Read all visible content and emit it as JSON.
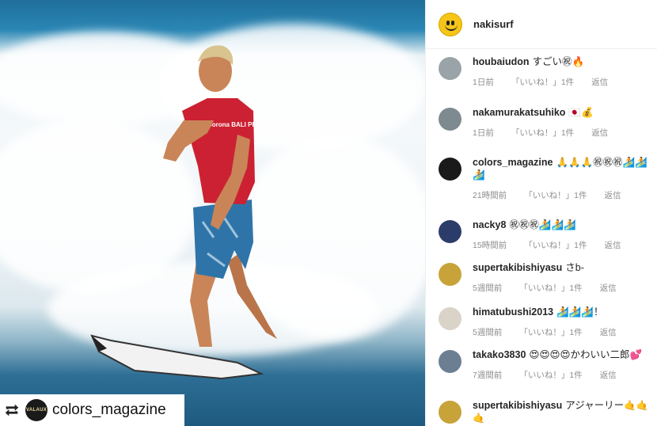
{
  "photo": {
    "repost_label": "colors_magazine",
    "repost_avatar_text": "VALAUX",
    "jersey_text": "Corona BALI PROTECTED"
  },
  "header": {
    "username": "nakisurf"
  },
  "comments": [
    {
      "user": "houbaiudon",
      "text": "すごい㊗🔥",
      "time": "1日前",
      "likes": "「いいね！」1件",
      "reply": "返信",
      "avatar_color": "#9aa3a8"
    },
    {
      "user": "nakamurakatsuhiko",
      "text": "🇯🇵💰",
      "time": "1日前",
      "likes": "「いいね！」1件",
      "reply": "返信",
      "avatar_color": "#7d8a90"
    },
    {
      "user": "colors_magazine",
      "text": "🙏🙏🙏㊗㊗㊗🏄🏄🏄",
      "time": "21時間前",
      "likes": "「いいね！」1件",
      "reply": "返信",
      "avatar_color": "#1a1a1a"
    },
    {
      "user": "nacky8",
      "text": "㊗㊗㊗🏄🏄🏄",
      "time": "15時間前",
      "likes": "「いいね！」1件",
      "reply": "返信",
      "avatar_color": "#2c3c6a"
    },
    {
      "user": "supertakibishiyasu",
      "text": "さb-",
      "time": "5週間前",
      "likes": "「いいね！」1件",
      "reply": "返信",
      "avatar_color": "#c7a33a"
    },
    {
      "user": "himatubushi2013",
      "text": "🏄🏄🏄！",
      "time": "5週間前",
      "likes": "「いいね！」1件",
      "reply": "返信",
      "avatar_color": "#d9d3c8"
    },
    {
      "user": "takako3830",
      "text": "😍😍😍😍かわいい二郎💕",
      "time": "7週間前",
      "likes": "「いいね！」1件",
      "reply": "返信",
      "avatar_color": "#6c7f92"
    },
    {
      "user": "supertakibishiyasu",
      "text": "アジャーリー🤙🤙🤙",
      "time": "",
      "likes": "",
      "reply": "",
      "avatar_color": "#c7a33a"
    }
  ]
}
